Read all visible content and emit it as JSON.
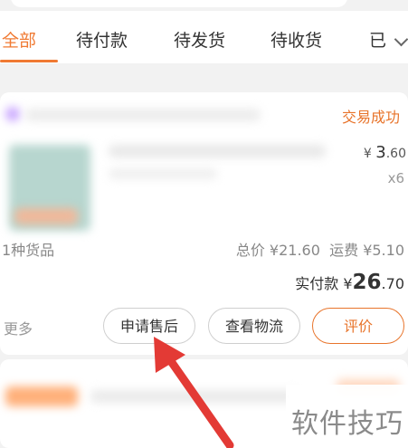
{
  "tabs": [
    {
      "label": "全部",
      "active": true
    },
    {
      "label": "待付款"
    },
    {
      "label": "待发货"
    },
    {
      "label": "待收货"
    },
    {
      "label": "已"
    }
  ],
  "order": {
    "status": "交易成功",
    "unit_price_prefix": "¥",
    "unit_price_main": "3",
    "unit_price_decimal": ".60",
    "quantity": "x6",
    "item_count": "1种货品",
    "total_label": "总价",
    "total_value": "¥21.60",
    "shipping_label": "运费",
    "shipping_value": "¥5.10",
    "paid_label": "实付款",
    "paid_prefix": "¥",
    "paid_main": "26",
    "paid_decimal": ".70",
    "more_label": "更多",
    "buttons": {
      "after_sale": "申请售后",
      "logistics": "查看物流",
      "rate": "评价"
    }
  },
  "watermark": "软件技巧",
  "colors": {
    "accent": "#f07a33",
    "annotation_arrow": "#e33a35"
  }
}
